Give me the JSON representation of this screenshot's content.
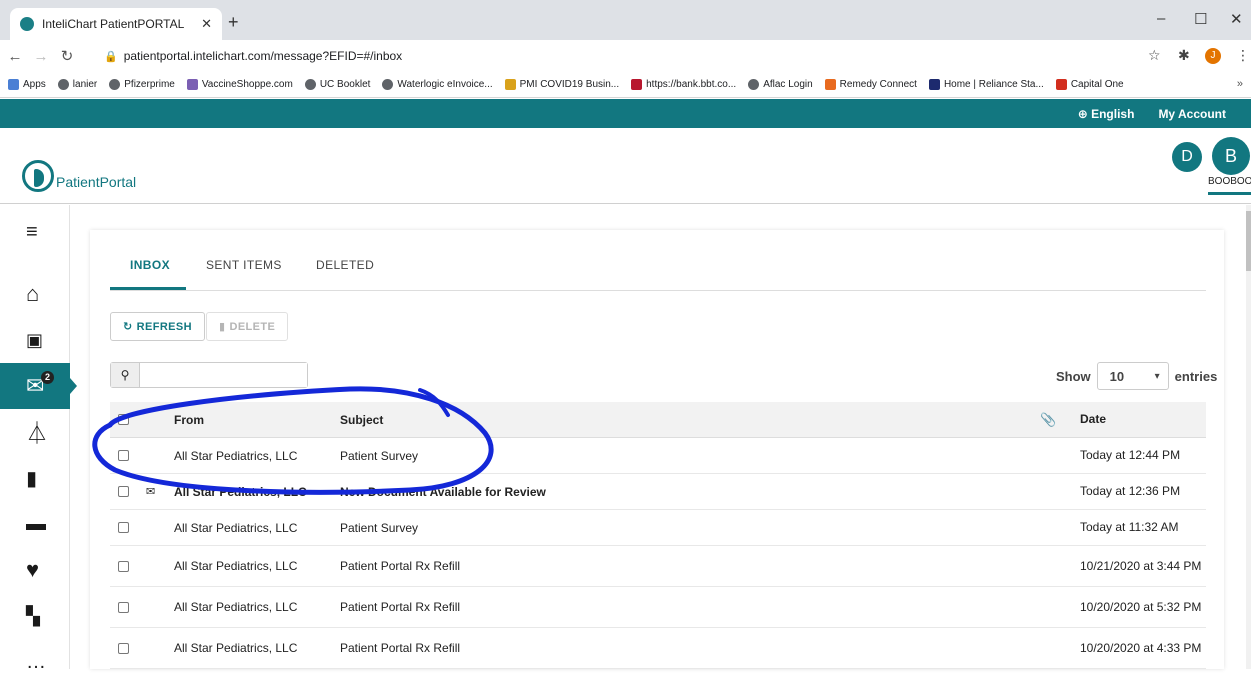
{
  "browser": {
    "tab_title": "InteliChart PatientPORTAL",
    "url": "patientportal.intelichart.com/message?EFID=#/inbox",
    "profile_initial": "J",
    "bookmarks": [
      "Apps",
      "lanier",
      "Pfizerprime",
      "VaccineShoppe.com",
      "UC Booklet",
      "Waterlogic eInvoice...",
      "PMI COVID19 Busin...",
      "https://bank.bbt.co...",
      "Aflac Login",
      "Remedy Connect",
      "Home | Reliance Sta...",
      "Capital One"
    ],
    "bookmark_more": "»"
  },
  "topbar": {
    "language": "English",
    "account": "My Account"
  },
  "header": {
    "logo_text": "PatientPortal",
    "avatar_d": "D",
    "avatar_b": "B",
    "username": "BOOBOO"
  },
  "sidebar": {
    "messages_badge": "2"
  },
  "tabs": {
    "inbox": "INBOX",
    "sent": "SENT ITEMS",
    "deleted": "DELETED"
  },
  "actions": {
    "refresh": "REFRESH",
    "delete": "DELETE"
  },
  "search": {
    "placeholder": ""
  },
  "entries": {
    "show": "Show",
    "value": "10",
    "suffix": "entries"
  },
  "table": {
    "columns": {
      "from": "From",
      "subject": "Subject",
      "date": "Date"
    },
    "rows": [
      {
        "from": "All Star Pediatrics, LLC",
        "subject": "Patient Survey",
        "date": "Today at 12:44 PM"
      },
      {
        "from": "All Star Pediatrics, LLC",
        "subject": "New Document Available for Review",
        "date": "Today at 12:36 PM"
      },
      {
        "from": "All Star Pediatrics, LLC",
        "subject": "Patient Survey",
        "date": "Today at 11:32 AM"
      },
      {
        "from": "All Star Pediatrics, LLC",
        "subject": "Patient Portal Rx Refill",
        "date": "10/21/2020 at 3:44 PM"
      },
      {
        "from": "All Star Pediatrics, LLC",
        "subject": "Patient Portal Rx Refill",
        "date": "10/20/2020 at 5:32 PM"
      },
      {
        "from": "All Star Pediatrics, LLC",
        "subject": "Patient Portal Rx Refill",
        "date": "10/20/2020 at 4:33 PM"
      }
    ]
  },
  "colors": {
    "brand": "#127780",
    "annotation": "#1428d8"
  }
}
